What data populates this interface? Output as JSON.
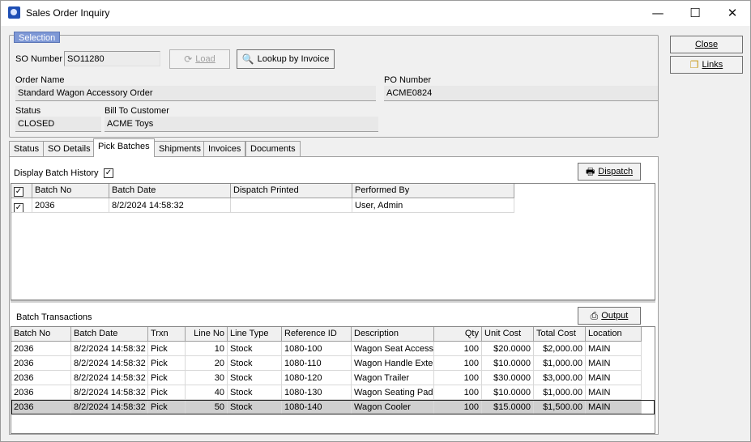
{
  "window": {
    "title": "Sales Order Inquiry",
    "controls": {
      "minimize": "—",
      "maximize": "☐",
      "close": "✕"
    }
  },
  "selection": {
    "legend": "Selection",
    "so_number_label": "SO Number",
    "so_number_value": "SO11280",
    "load_label": "Load",
    "lookup_label": "Lookup by Invoice",
    "order_name_label": "Order Name",
    "order_name_value": "Standard Wagon Accessory Order",
    "po_number_label": "PO Number",
    "po_number_value": "ACME0824",
    "status_label": "Status",
    "status_value": "CLOSED",
    "bill_to_label": "Bill To Customer",
    "bill_to_value": "ACME Toys"
  },
  "side_buttons": {
    "close": "Close",
    "links": "Links"
  },
  "tabs": [
    {
      "label": "Status"
    },
    {
      "label": "SO Details"
    },
    {
      "label": "Pick Batches"
    },
    {
      "label": "Shipments"
    },
    {
      "label": "Invoices"
    },
    {
      "label": "Documents"
    }
  ],
  "active_tab": "Pick Batches",
  "batches": {
    "display_history_label": "Display Batch History",
    "display_history_checked": true,
    "dispatch_label": "Dispatch",
    "columns": [
      "Batch No",
      "Batch Date",
      "Dispatch Printed",
      "Performed By"
    ],
    "rows": [
      {
        "checked": true,
        "batch_no": "2036",
        "batch_date": "8/2/2024 14:58:32",
        "dispatch_printed": "",
        "performed_by": "User, Admin"
      }
    ]
  },
  "transactions": {
    "title": "Batch Transactions",
    "output_label": "Output",
    "columns": [
      "Batch No",
      "Batch Date",
      "Trxn",
      "Line No",
      "Line Type",
      "Reference ID",
      "Description",
      "Qty",
      "Unit Cost",
      "Total Cost",
      "Location"
    ],
    "rows": [
      {
        "batch_no": "2036",
        "batch_date": "8/2/2024 14:58:32",
        "trxn": "Pick",
        "line_no": "10",
        "line_type": "Stock",
        "reference_id": "1080-100",
        "description": "Wagon Seat Accessory",
        "qty": "100",
        "unit_cost": "$20.0000",
        "total_cost": "$2,000.00",
        "location": "MAIN"
      },
      {
        "batch_no": "2036",
        "batch_date": "8/2/2024 14:58:32",
        "trxn": "Pick",
        "line_no": "20",
        "line_type": "Stock",
        "reference_id": "1080-110",
        "description": "Wagon Handle Extension",
        "qty": "100",
        "unit_cost": "$10.0000",
        "total_cost": "$1,000.00",
        "location": "MAIN"
      },
      {
        "batch_no": "2036",
        "batch_date": "8/2/2024 14:58:32",
        "trxn": "Pick",
        "line_no": "30",
        "line_type": "Stock",
        "reference_id": "1080-120",
        "description": "Wagon Trailer",
        "qty": "100",
        "unit_cost": "$30.0000",
        "total_cost": "$3,000.00",
        "location": "MAIN"
      },
      {
        "batch_no": "2036",
        "batch_date": "8/2/2024 14:58:32",
        "trxn": "Pick",
        "line_no": "40",
        "line_type": "Stock",
        "reference_id": "1080-130",
        "description": "Wagon Seating Pad",
        "qty": "100",
        "unit_cost": "$10.0000",
        "total_cost": "$1,000.00",
        "location": "MAIN"
      },
      {
        "batch_no": "2036",
        "batch_date": "8/2/2024 14:58:32",
        "trxn": "Pick",
        "line_no": "50",
        "line_type": "Stock",
        "reference_id": "1080-140",
        "description": "Wagon Cooler",
        "qty": "100",
        "unit_cost": "$15.0000",
        "total_cost": "$1,500.00",
        "location": "MAIN",
        "selected": true
      }
    ]
  }
}
